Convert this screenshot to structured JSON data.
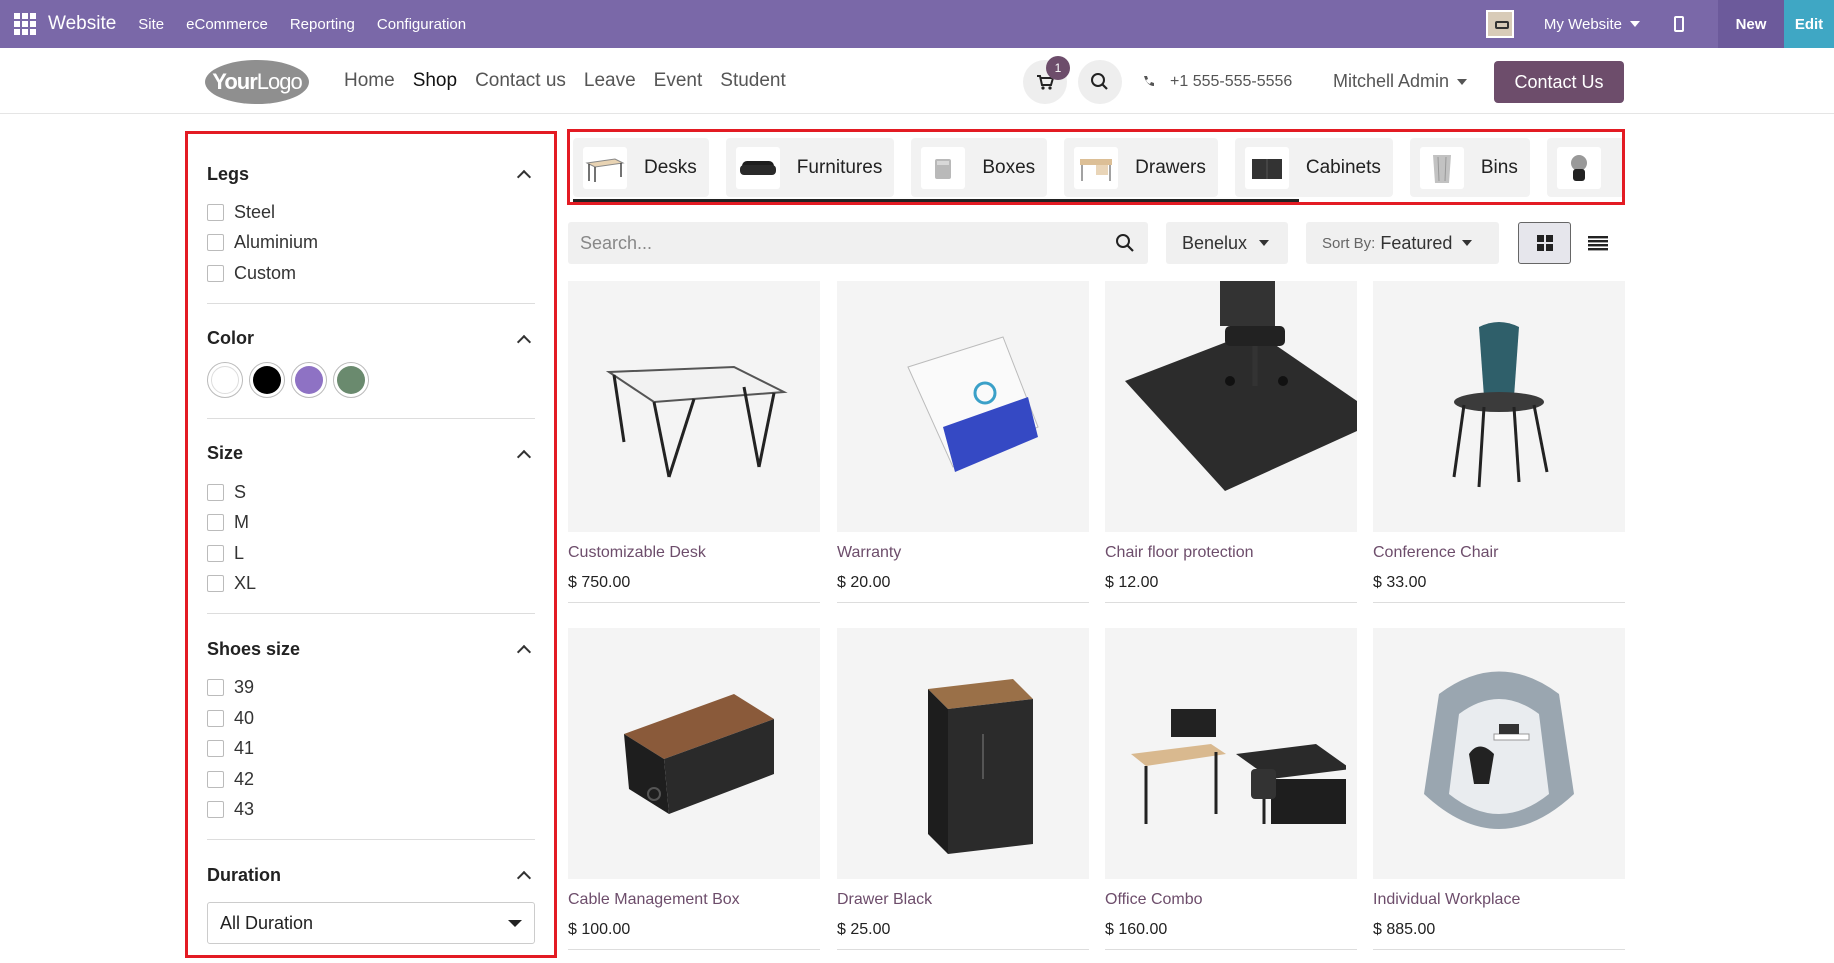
{
  "admin_bar": {
    "app_name": "Website",
    "menu": [
      "Site",
      "eCommerce",
      "Reporting",
      "Configuration"
    ],
    "website_selector": "My Website",
    "new_label": "New",
    "edit_label": "Edit",
    "background_color": "#7a68a8"
  },
  "header": {
    "logo_text_bold": "Your",
    "logo_text_light": "Logo",
    "nav": [
      "Home",
      "Shop",
      "Contact us",
      "Leave",
      "Event",
      "Student"
    ],
    "active_nav": "Shop",
    "cart_count": "1",
    "phone": "+1 555-555-5556",
    "user": "Mitchell Admin",
    "contact_button": "Contact Us",
    "brand_color": "#6d4d6b"
  },
  "filters": {
    "legs": {
      "title": "Legs",
      "options": [
        "Steel",
        "Aluminium",
        "Custom"
      ]
    },
    "color": {
      "title": "Color",
      "swatches": [
        "#ffffff",
        "#000000",
        "#8e72c4",
        "#6a8a6e"
      ]
    },
    "size": {
      "title": "Size",
      "options": [
        "S",
        "M",
        "L",
        "XL"
      ]
    },
    "shoes_size": {
      "title": "Shoes size",
      "options": [
        "39",
        "40",
        "41",
        "42",
        "43"
      ]
    },
    "duration": {
      "title": "Duration",
      "selected": "All Duration"
    }
  },
  "categories": [
    {
      "label": "Desks",
      "icon": "desk-icon"
    },
    {
      "label": "Furnitures",
      "icon": "sofa-icon"
    },
    {
      "label": "Boxes",
      "icon": "box-icon"
    },
    {
      "label": "Drawers",
      "icon": "drawer-icon"
    },
    {
      "label": "Cabinets",
      "icon": "cabinet-icon"
    },
    {
      "label": "Bins",
      "icon": "bin-icon"
    },
    {
      "label": "",
      "icon": "lamp-icon"
    }
  ],
  "toolbar": {
    "search_placeholder": "Search...",
    "pricelist": "Benelux",
    "sort_label": "Sort By:",
    "sort_value": "Featured"
  },
  "products": [
    {
      "name": "Customizable Desk",
      "price": "$ 750.00",
      "icon": "desk-product"
    },
    {
      "name": "Warranty",
      "price": "$ 20.00",
      "icon": "warranty-box"
    },
    {
      "name": "Chair floor protection",
      "price": "$ 12.00",
      "icon": "floor-mat"
    },
    {
      "name": "Conference Chair",
      "price": "$ 33.00",
      "icon": "chair"
    },
    {
      "name": "Cable Management Box",
      "price": "$ 100.00",
      "icon": "cable-box"
    },
    {
      "name": "Drawer Black",
      "price": "$ 25.00",
      "icon": "drawer-black"
    },
    {
      "name": "Office Combo",
      "price": "$ 160.00",
      "icon": "office-combo"
    },
    {
      "name": "Individual Workplace",
      "price": "$ 885.00",
      "icon": "workplace-pod"
    }
  ]
}
